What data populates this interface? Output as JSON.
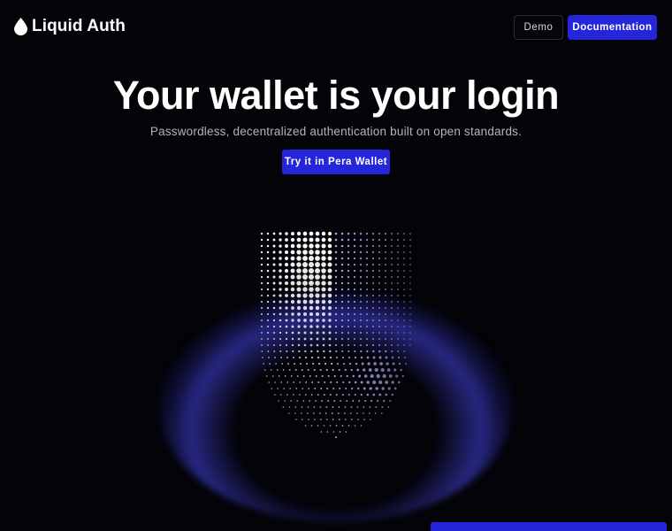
{
  "brand": {
    "name": "Liquid Auth",
    "logo_icon": "droplet-icon"
  },
  "nav": {
    "demo_label": "Demo",
    "docs_label": "Documentation"
  },
  "hero": {
    "title": "Your wallet is your login",
    "subtitle": "Passwordless, decentralized authentication built on open standards.",
    "cta_label": "Try it in Pera Wallet"
  },
  "illustration": {
    "icon": "shield-icon"
  },
  "colors": {
    "background": "#030308",
    "accent": "#2525d9",
    "shield_left": "#ffffff",
    "shield_right": "#a8a8f0",
    "glow": "#4646e6"
  }
}
